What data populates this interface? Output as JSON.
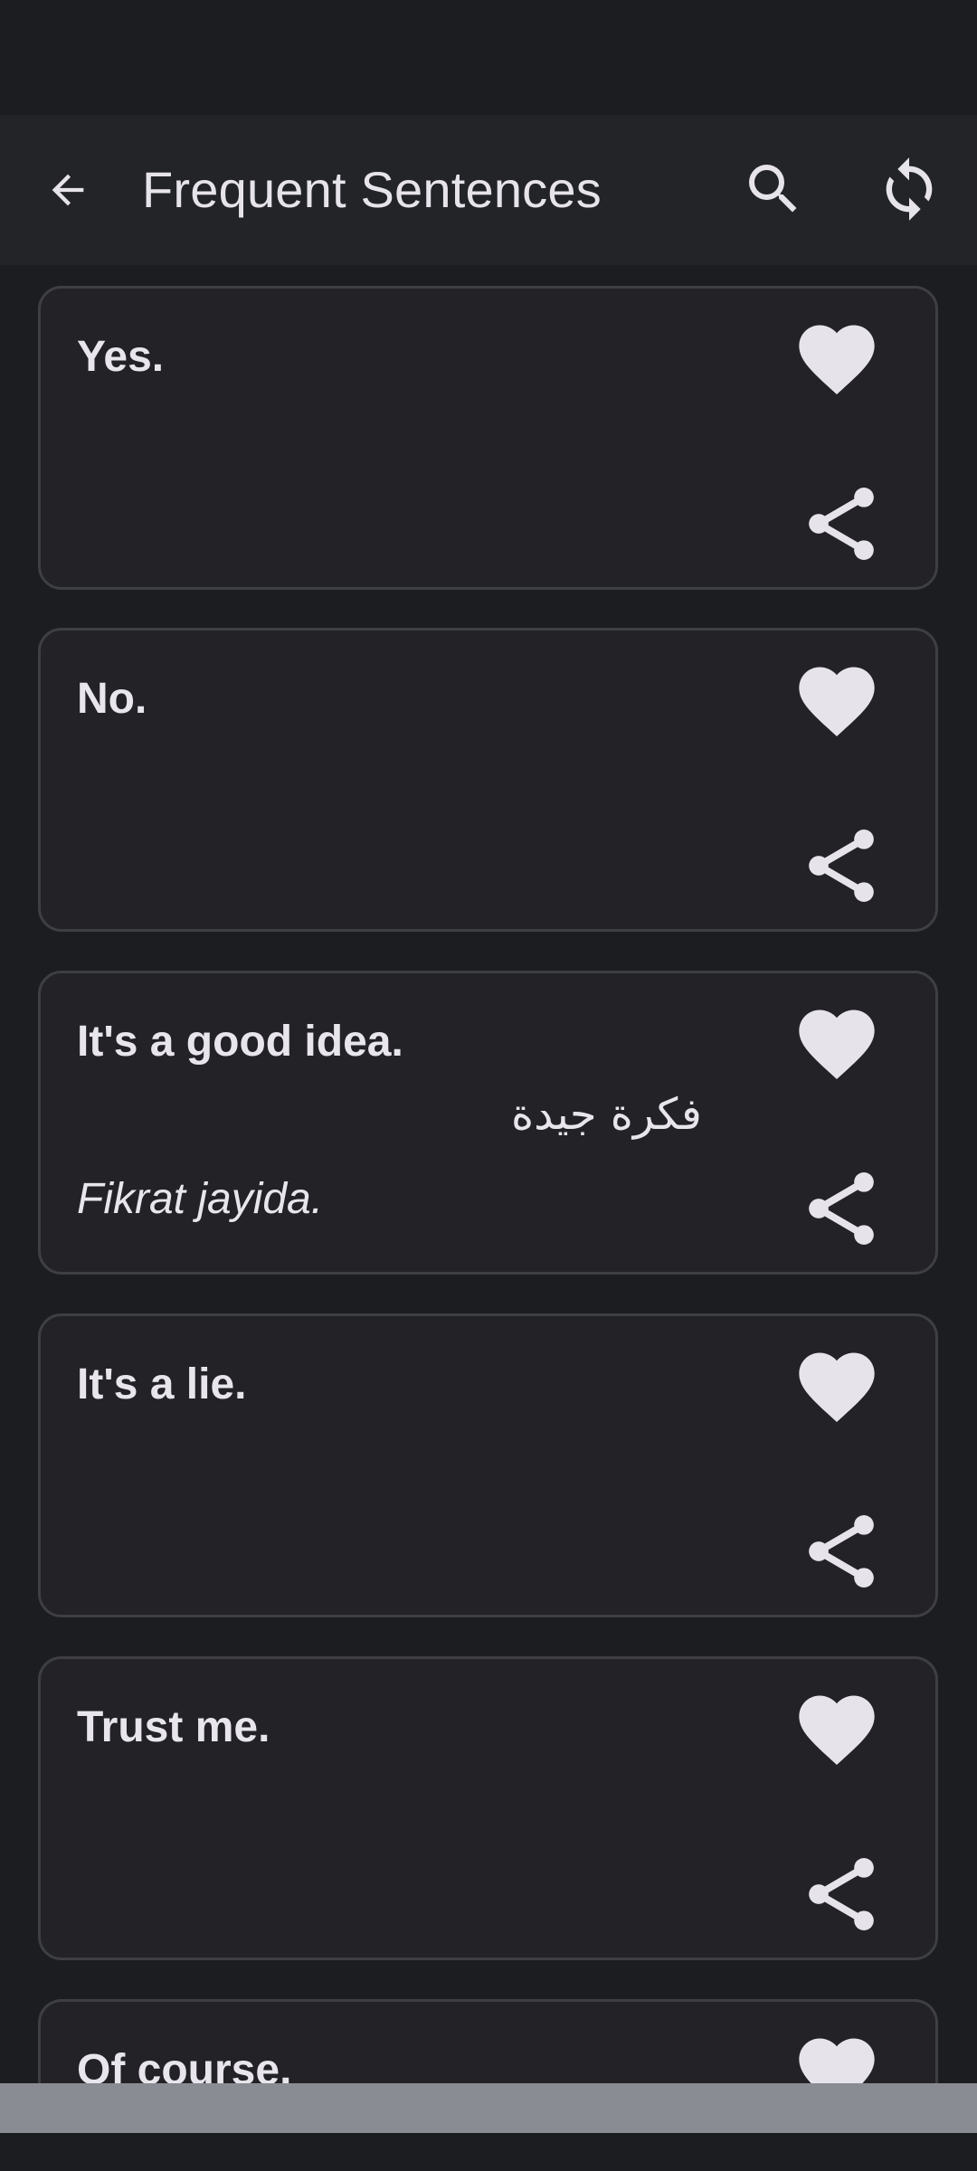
{
  "app_bar": {
    "title": "Frequent Sentences"
  },
  "icons": {
    "back": "arrow-back",
    "search": "magnifier",
    "refresh": "sync-arrows",
    "favorite": "heart",
    "share": "share-nodes"
  },
  "colors": {
    "background": "#1c1d20",
    "app_bar": "#232428",
    "card": "#222227",
    "card_border": "#3e3f45",
    "text": "#e8e6ec",
    "bottom_bar": "#8a8c94"
  },
  "cards": [
    {
      "phrase": "Yes.",
      "arabic": "",
      "translit": ""
    },
    {
      "phrase": "No.",
      "arabic": "",
      "translit": ""
    },
    {
      "phrase": "It's a good idea.",
      "arabic": "فكرة جيدة",
      "translit": "Fikrat jayida."
    },
    {
      "phrase": "It's a lie.",
      "arabic": "",
      "translit": ""
    },
    {
      "phrase": "Trust me.",
      "arabic": "",
      "translit": ""
    },
    {
      "phrase": "Of course.",
      "arabic": "",
      "translit": ""
    }
  ]
}
